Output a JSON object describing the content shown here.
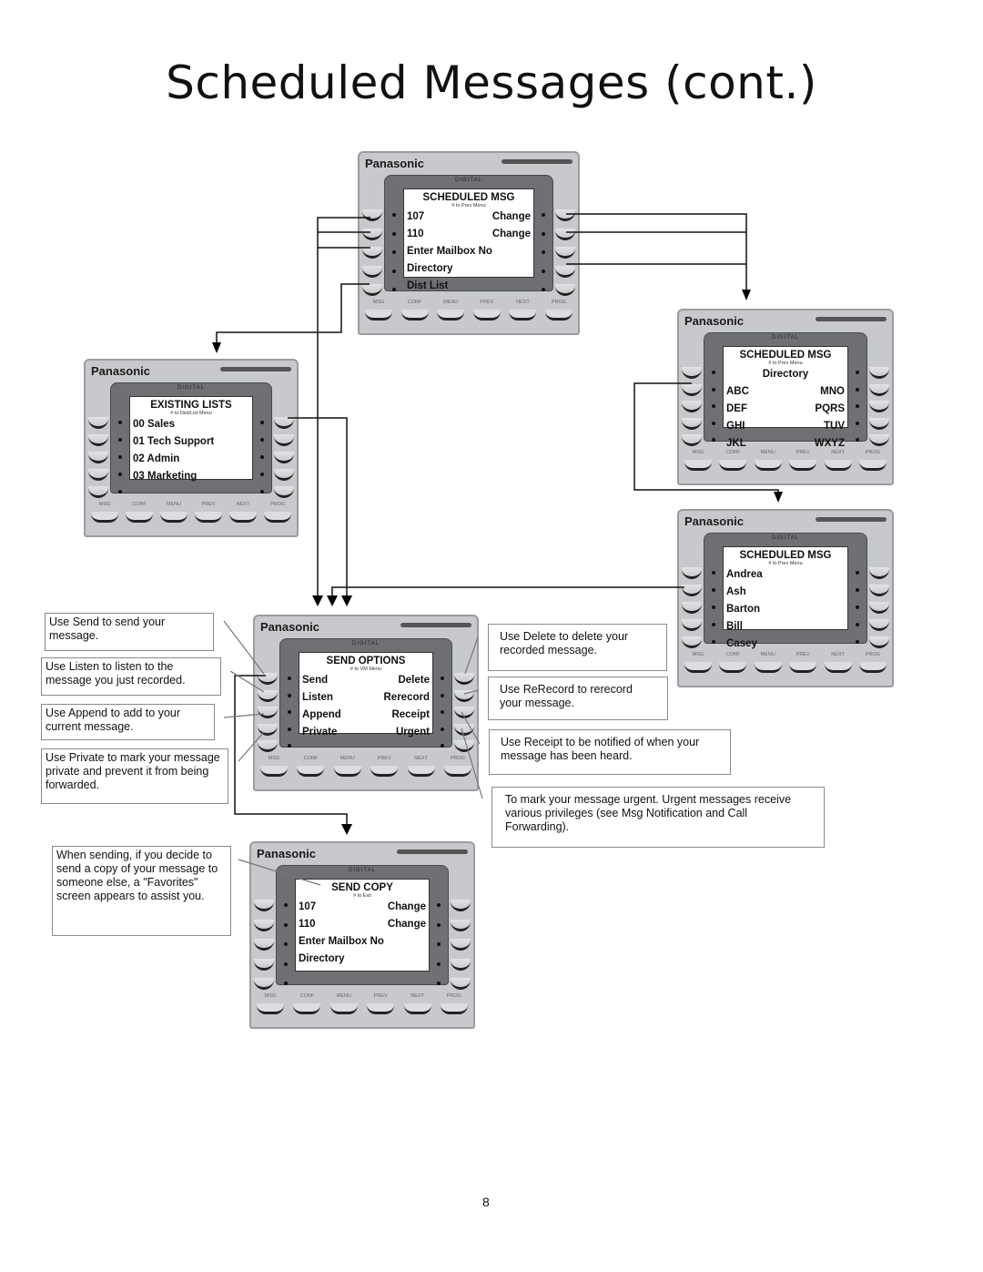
{
  "page": {
    "title": "Scheduled Messages (cont.)",
    "page_number": "8"
  },
  "phone_common": {
    "brand": "Panasonic",
    "bezel_label": "DIGITAL",
    "function_keys": [
      "MSG",
      "CONF",
      "MENU",
      "PREV",
      "NEXT",
      "PROG"
    ]
  },
  "screens": {
    "scheduled_msg_main": {
      "heading": "SCHEDULED MSG",
      "subheading": "# to Prev Menu",
      "rows": [
        {
          "left": "107",
          "right": "Change"
        },
        {
          "left": "110",
          "right": "Change"
        },
        {
          "left": "Enter Mailbox No",
          "right": ""
        },
        {
          "left": "Directory",
          "right": ""
        },
        {
          "left": "Dist List",
          "right": ""
        }
      ]
    },
    "existing_lists": {
      "heading": "EXISTING LISTS",
      "subheading": "# to Dist/List Menu",
      "rows": [
        {
          "left": "00 Sales",
          "right": ""
        },
        {
          "left": "01 Tech Support",
          "right": ""
        },
        {
          "left": "02 Admin",
          "right": ""
        },
        {
          "left": "03 Marketing",
          "right": ""
        },
        {
          "left": "",
          "right": ""
        }
      ]
    },
    "scheduled_msg_directory": {
      "heading": "SCHEDULED MSG",
      "subheading": "# to Prev Menu",
      "title_row": "Directory",
      "rows": [
        {
          "left": "ABC",
          "right": "MNO"
        },
        {
          "left": "DEF",
          "right": "PQRS"
        },
        {
          "left": "GHI",
          "right": "TUV"
        },
        {
          "left": "JKL",
          "right": "WXYZ"
        }
      ]
    },
    "scheduled_msg_names": {
      "heading": "SCHEDULED MSG",
      "subheading": "# to Prev Menu",
      "rows": [
        {
          "left": "Andrea",
          "right": ""
        },
        {
          "left": "Ash",
          "right": ""
        },
        {
          "left": "Barton",
          "right": ""
        },
        {
          "left": "Bill",
          "right": ""
        },
        {
          "left": "Casey",
          "right": ""
        }
      ]
    },
    "send_options": {
      "heading": "SEND OPTIONS",
      "subheading": "# to VM Menu",
      "rows": [
        {
          "left": "Send",
          "right": "Delete"
        },
        {
          "left": "Listen",
          "right": "Rerecord"
        },
        {
          "left": "Append",
          "right": "Receipt"
        },
        {
          "left": "Private",
          "right": "Urgent"
        },
        {
          "left": "",
          "right": ""
        }
      ]
    },
    "send_copy": {
      "heading": "SEND COPY",
      "subheading": "# to Exit",
      "rows": [
        {
          "left": "107",
          "right": "Change"
        },
        {
          "left": "110",
          "right": "Change"
        },
        {
          "left": "Enter Mailbox No",
          "right": ""
        },
        {
          "left": "Directory",
          "right": ""
        },
        {
          "left": "",
          "right": ""
        }
      ]
    }
  },
  "notes": {
    "send": "Use Send  to send your message.",
    "listen": "Use Listen to listen to the message you just recorded.",
    "append": "Use Append to add to your current message.",
    "private": "Use Private to mark your message private and prevent it from being forwarded.",
    "delete": "Use Delete to delete your recorded message.",
    "rerecord": "Use ReRecord to rerecord your message.",
    "receipt": "Use Receipt to be notified of when your message has been heard.",
    "urgent": "To mark your message urgent.  Urgent messages receive various privileges (see Msg Notification and Call Forwarding).",
    "send_copy": "When sending, if you decide to send a copy of your message to someone else, a \"Favorites\" screen appears to assist you."
  }
}
